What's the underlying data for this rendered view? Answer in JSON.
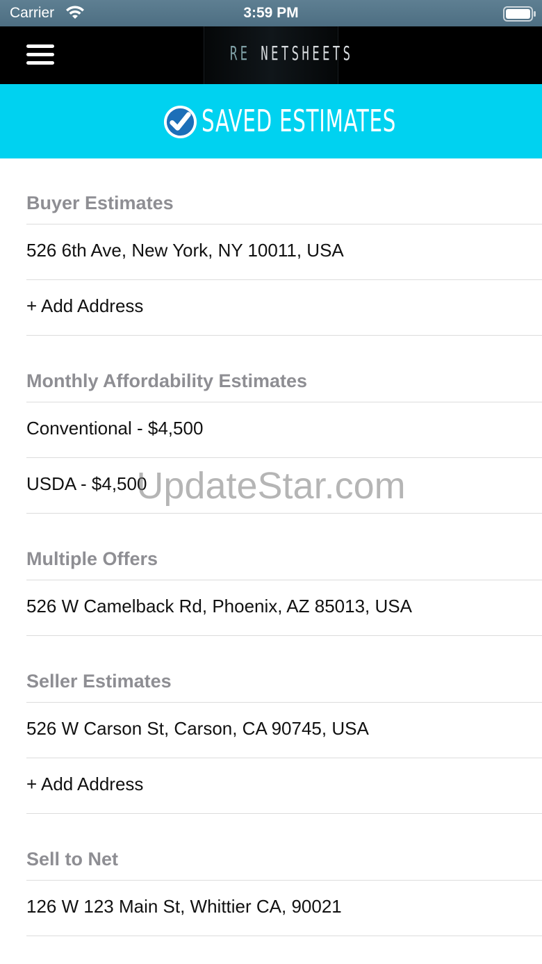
{
  "status_bar": {
    "carrier": "Carrier",
    "time": "3:59 PM"
  },
  "nav": {
    "logo_prefix": "RE",
    "logo_main": "NETSHEETS"
  },
  "header": {
    "title": "SAVED ESTIMATES",
    "background": "#00d2f0"
  },
  "sections": [
    {
      "title": "Buyer Estimates",
      "rows": [
        "526 6th Ave, New York, NY 10011, USA",
        "+ Add Address"
      ]
    },
    {
      "title": "Monthly Affordability Estimates",
      "rows": [
        "Conventional - $4,500",
        "USDA - $4,500"
      ]
    },
    {
      "title": "Multiple Offers",
      "rows": [
        "526 W Camelback Rd, Phoenix, AZ 85013, USA"
      ]
    },
    {
      "title": "Seller Estimates",
      "rows": [
        "526 W Carson St, Carson, CA 90745, USA",
        "+ Add Address"
      ]
    },
    {
      "title": "Sell to Net",
      "rows": [
        "126 W 123 Main St, Whittier CA, 90021"
      ]
    }
  ],
  "watermark": "UpdateStar.com"
}
